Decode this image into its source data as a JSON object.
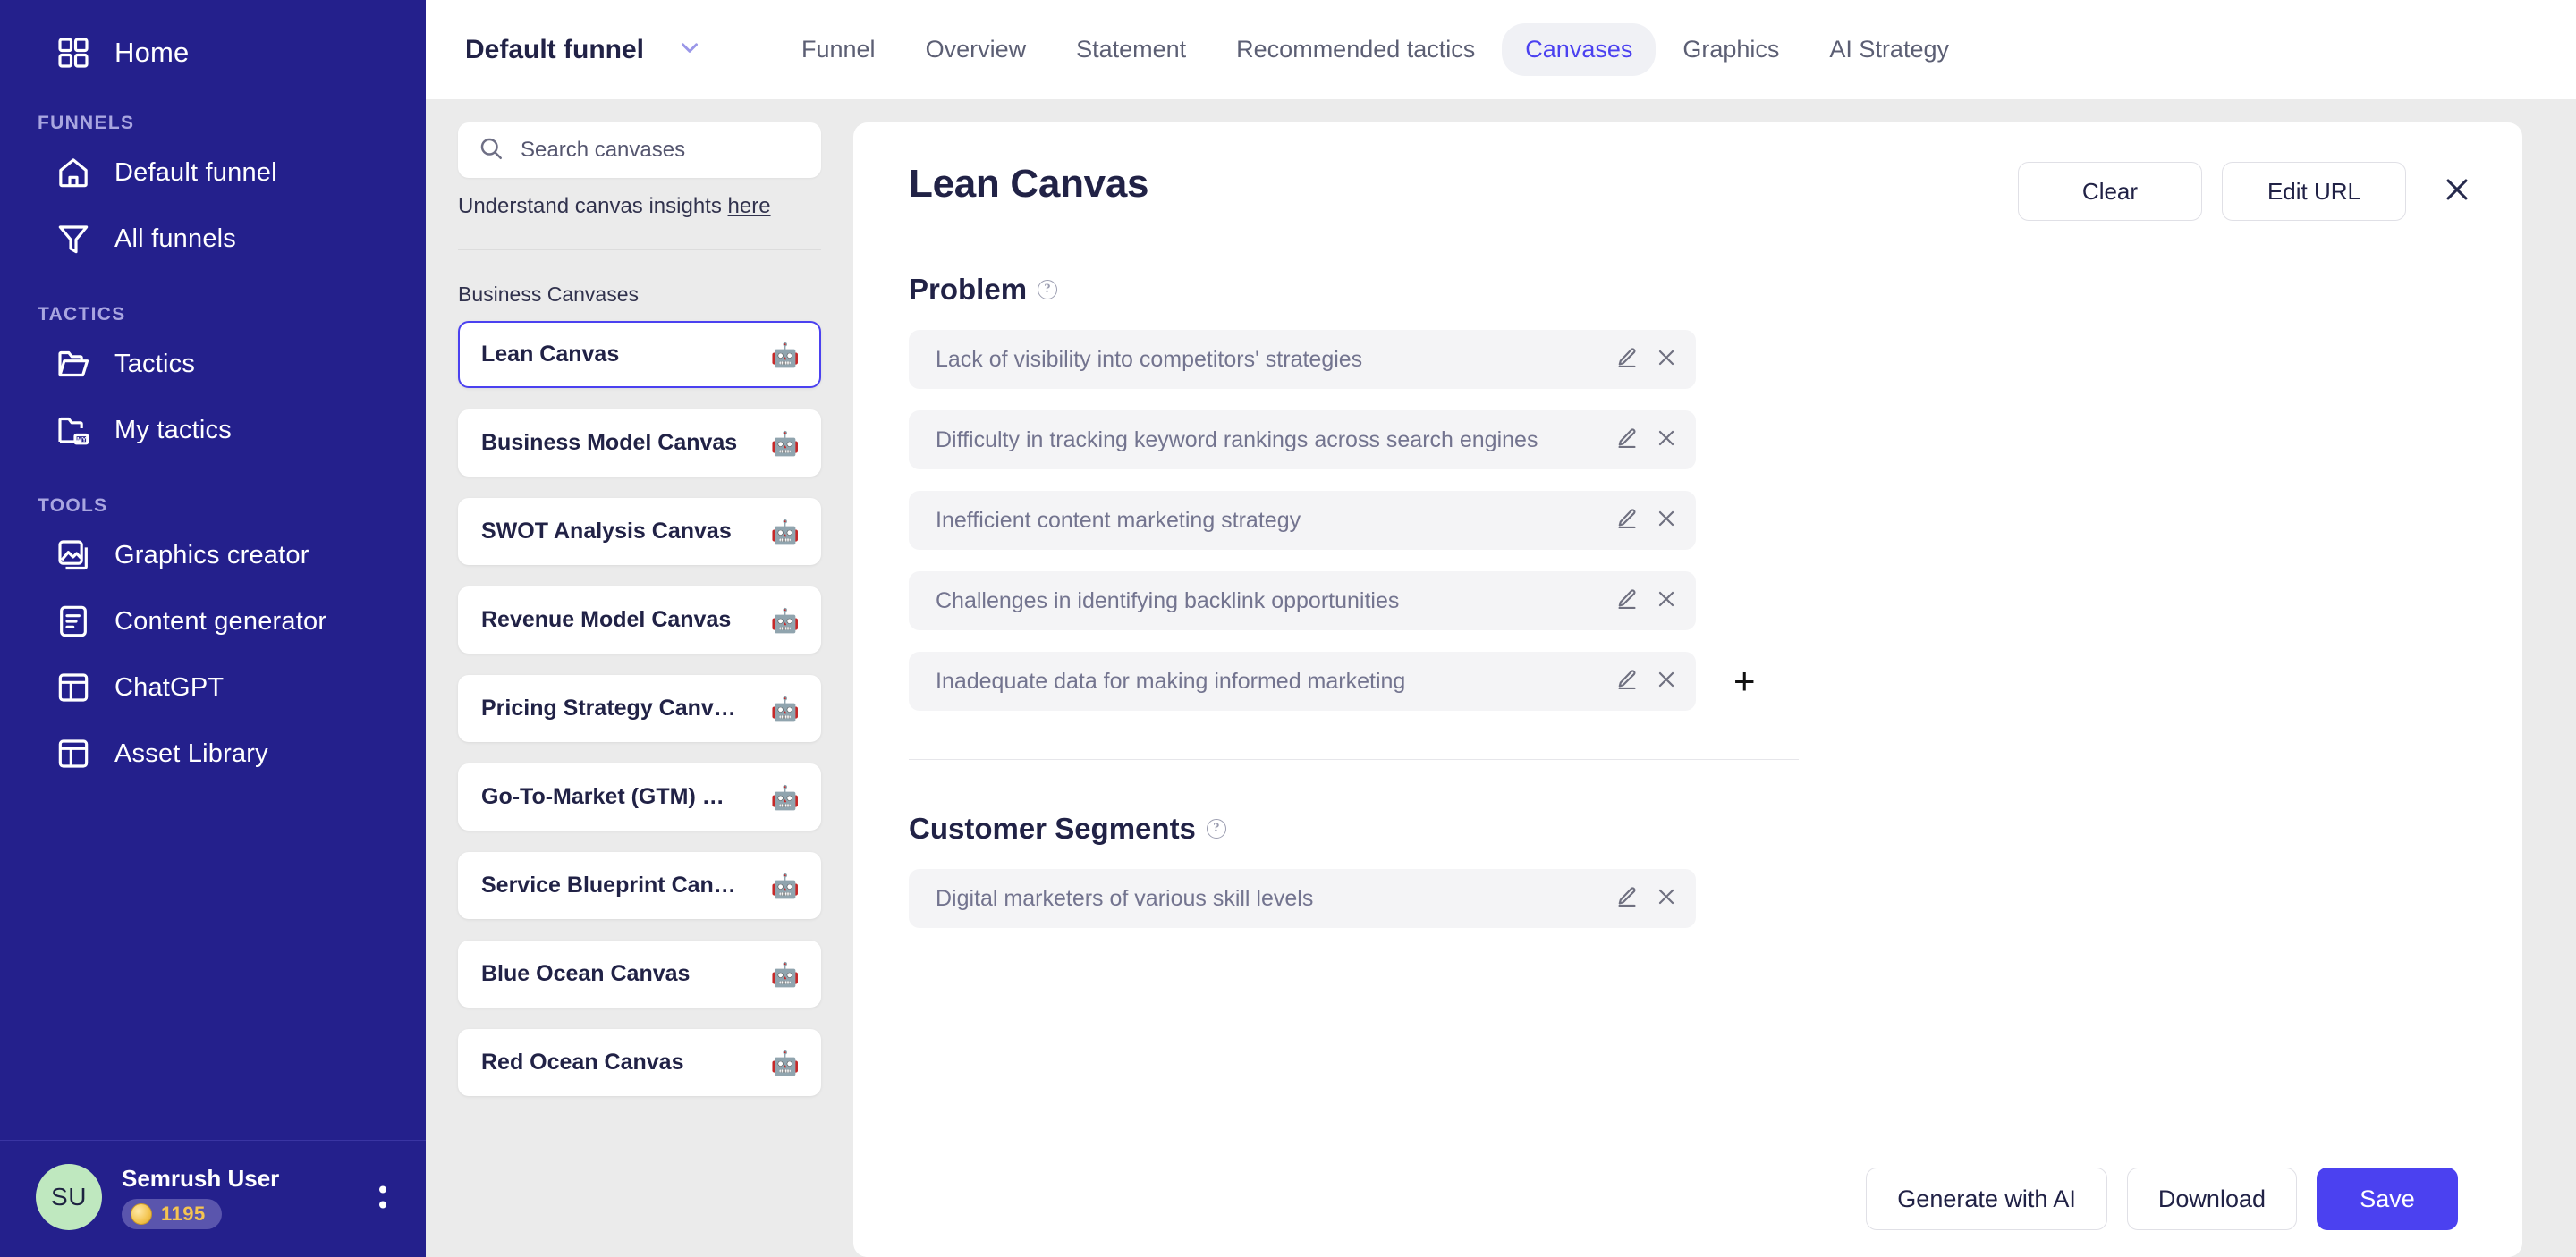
{
  "sidebar": {
    "home": {
      "label": "Home",
      "icon": "grid-icon"
    },
    "sections": [
      {
        "title": "FUNNELS",
        "items": [
          {
            "label": "Default funnel",
            "icon": "house-icon"
          },
          {
            "label": "All funnels",
            "icon": "funnel-icon"
          }
        ]
      },
      {
        "title": "TACTICS",
        "items": [
          {
            "label": "Tactics",
            "icon": "folder-open-icon"
          },
          {
            "label": "My tactics",
            "icon": "folder-my-icon"
          }
        ]
      },
      {
        "title": "TOOLS",
        "items": [
          {
            "label": "Graphics creator",
            "icon": "image-icon"
          },
          {
            "label": "Content generator",
            "icon": "document-lines-icon"
          },
          {
            "label": "ChatGPT",
            "icon": "layout-icon"
          },
          {
            "label": "Asset Library",
            "icon": "layout-icon"
          }
        ]
      }
    ],
    "user": {
      "initials": "SU",
      "name": "Semrush User",
      "credits": "1195",
      "credits_icon": "coin-icon",
      "menu_icon": "kebab-menu-icon"
    }
  },
  "topbar": {
    "funnel_name": "Default funnel",
    "chevron_icon": "chevron-down-icon",
    "tabs": [
      {
        "label": "Funnel",
        "active": false
      },
      {
        "label": "Overview",
        "active": false
      },
      {
        "label": "Statement",
        "active": false
      },
      {
        "label": "Recommended tactics",
        "active": false
      },
      {
        "label": "Canvases",
        "active": true
      },
      {
        "label": "Graphics",
        "active": false
      },
      {
        "label": "AI Strategy",
        "active": false
      }
    ]
  },
  "canvas_list": {
    "search": {
      "placeholder": "Search canvases",
      "value": "",
      "icon": "search-icon"
    },
    "insights_text": "Understand canvas insights",
    "insights_link": "here",
    "group_title": "Business Canvases",
    "item_icon": "robot-emoji",
    "items": [
      {
        "label": "Lean Canvas",
        "selected": true
      },
      {
        "label": "Business Model Canvas",
        "selected": false
      },
      {
        "label": "SWOT Analysis Canvas",
        "selected": false
      },
      {
        "label": "Revenue Model Canvas",
        "selected": false
      },
      {
        "label": "Pricing Strategy Canv…",
        "selected": false
      },
      {
        "label": "Go-To-Market (GTM) …",
        "selected": false
      },
      {
        "label": "Service Blueprint Can…",
        "selected": false
      },
      {
        "label": "Blue Ocean Canvas",
        "selected": false
      },
      {
        "label": "Red Ocean Canvas",
        "selected": false
      }
    ]
  },
  "panel": {
    "title": "Lean Canvas",
    "clear_label": "Clear",
    "edit_url_label": "Edit URL",
    "close_icon": "close-icon",
    "add_icon": "plus-icon",
    "row_edit_icon": "pencil-icon",
    "row_delete_icon": "close-icon",
    "help_icon": "question-circle-icon",
    "sections": [
      {
        "title": "Problem",
        "items": [
          "Lack of visibility into competitors' strategies",
          "Difficulty in tracking keyword rankings across search engines",
          "Inefficient content marketing strategy",
          "Challenges in identifying backlink opportunities",
          "Inadequate data for making informed marketing"
        ]
      },
      {
        "title": "Customer Segments",
        "items": [
          "Digital marketers of various skill levels"
        ]
      }
    ]
  },
  "actionbar": {
    "generate_label": "Generate with AI",
    "download_label": "Download",
    "save_label": "Save"
  },
  "colors": {
    "sidebar_bg": "#24208c",
    "accent": "#4b41f0",
    "page_bg": "#ebebeb",
    "text_dark": "#212246",
    "muted": "#73748f",
    "avatar_bg": "#bfe8bf",
    "coin": "#f5c451"
  }
}
